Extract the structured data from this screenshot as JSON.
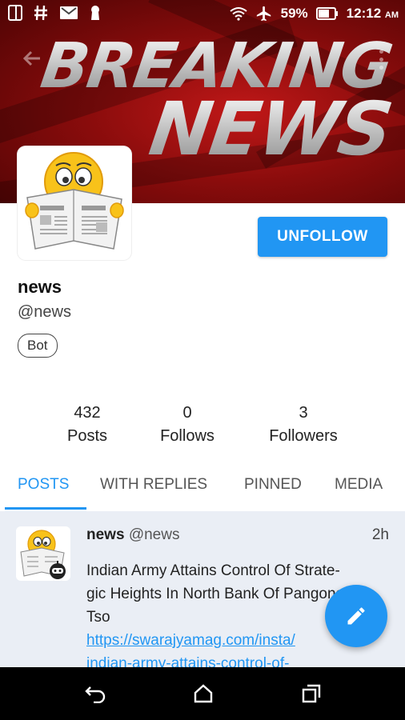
{
  "status_bar": {
    "battery": "59%",
    "time": "12:12",
    "ampm": "AM"
  },
  "banner": {
    "line1": "BREAKING",
    "line2": "NEWS"
  },
  "profile": {
    "display_name": "news",
    "handle": "@news",
    "badge": "Bot",
    "follow_button": "UNFOLLOW"
  },
  "stats": [
    {
      "value": "432",
      "label": "Posts"
    },
    {
      "value": "0",
      "label": "Follows"
    },
    {
      "value": "3",
      "label": "Followers"
    }
  ],
  "tabs": [
    "POSTS",
    "WITH REPLIES",
    "PINNED",
    "MEDIA"
  ],
  "post": {
    "name": "news",
    "handle": "@news",
    "time": "2h",
    "text_line1": "Indian Army Attains Control Of Strate-",
    "text_line2": "gic Heights In North Bank Of Pangong",
    "text_line3": "Tso",
    "link_line1": "https://swarajyamag.com/insta/",
    "link_line2": "indian-army-attains-control-of-"
  },
  "colors": {
    "accent": "#2196f3",
    "banner_red": "#8a0c0c",
    "feed_bg": "#eaeef5"
  },
  "icons": [
    "sim-icon",
    "hash-icon",
    "gmail-icon",
    "keyhole-icon",
    "wifi-icon",
    "airplane-icon",
    "battery-icon",
    "back-arrow-icon",
    "more-vert-icon",
    "pencil-icon",
    "nav-back-icon",
    "nav-home-icon",
    "nav-recents-icon"
  ]
}
